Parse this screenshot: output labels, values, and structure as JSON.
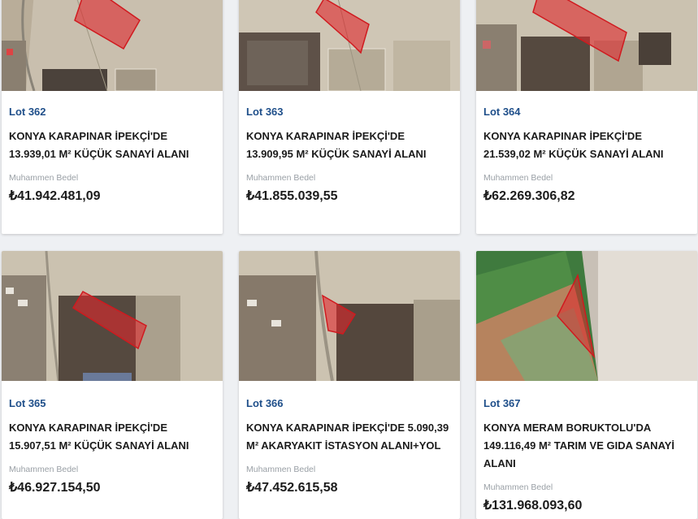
{
  "lots": [
    {
      "lot": "Lot 362",
      "title": "KONYA KARAPINAR İPEKÇİ'DE 13.939,01 M² KÜÇÜK SANAYİ ALANI",
      "label": "Muhammen Bedel",
      "price": "₺41.942.481,09"
    },
    {
      "lot": "Lot 363",
      "title": "KONYA KARAPINAR İPEKÇİ'DE 13.909,95 M² KÜÇÜK SANAYİ ALANI",
      "label": "Muhammen Bedel",
      "price": "₺41.855.039,55"
    },
    {
      "lot": "Lot 364",
      "title": "KONYA KARAPINAR İPEKÇİ'DE 21.539,02 M² KÜÇÜK SANAYİ ALANI",
      "label": "Muhammen Bedel",
      "price": "₺62.269.306,82"
    },
    {
      "lot": "Lot 365",
      "title": "KONYA KARAPINAR İPEKÇİ'DE 15.907,51 M² KÜÇÜK SANAYİ ALANI",
      "label": "Muhammen Bedel",
      "price": "₺46.927.154,50"
    },
    {
      "lot": "Lot 366",
      "title": "KONYA KARAPINAR İPEKÇİ'DE 5.090,39 M² AKARYAKIT İSTASYON ALANI+YOL",
      "label": "Muhammen Bedel",
      "price": "₺47.452.615,58"
    },
    {
      "lot": "Lot 367",
      "title": "KONYA MERAM BORUKTOLU'DA 149.116,49 M² TARIM VE GIDA SANAYİ ALANI",
      "label": "Muhammen Bedel",
      "price": "₺131.968.093,60"
    }
  ]
}
